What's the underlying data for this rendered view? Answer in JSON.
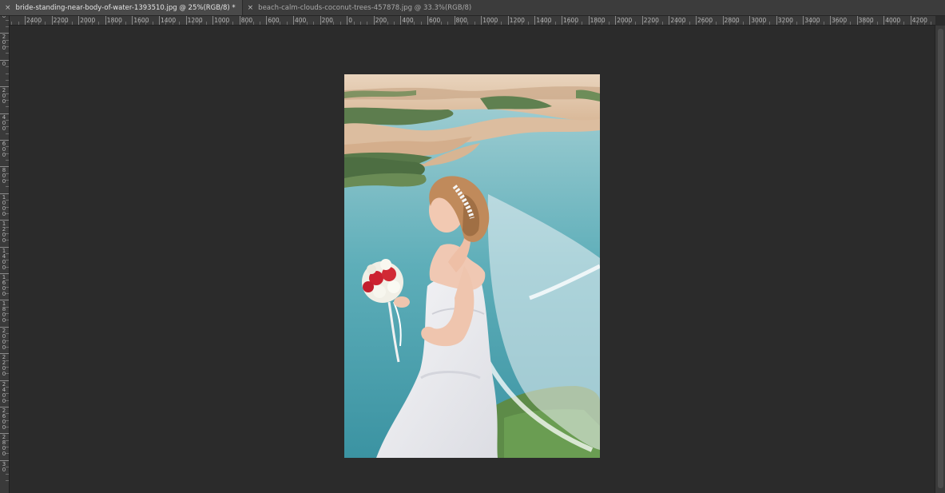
{
  "tabs": [
    {
      "label": "bride-standing-near-body-of-water-1393510.jpg @ 25%(RGB/8) *",
      "active": true,
      "close_icon": "×"
    },
    {
      "label": "beach-calm-clouds-coconut-trees-457878.jpg @ 33.3%(RGB/8)",
      "active": false,
      "close_icon": "×"
    }
  ],
  "ruler": {
    "horizontal_labels": [
      "2400",
      "2200",
      "2000",
      "1800",
      "1600",
      "1400",
      "1200",
      "1000",
      "800",
      "600",
      "400",
      "200",
      "0",
      "200",
      "400",
      "600",
      "800",
      "1000",
      "1200",
      "1400",
      "1600",
      "1800",
      "2000",
      "2200",
      "2400",
      "2600",
      "2800",
      "3000",
      "3200",
      "3400",
      "3600",
      "3800",
      "4000",
      "4200",
      "4"
    ],
    "vertical_labels": [
      "4\n0",
      "2\n0\n0",
      "0",
      "2\n0\n0",
      "4\n0\n0",
      "6\n0\n0",
      "8\n0\n0",
      "1\n0\n0\n0",
      "1\n2\n0\n0",
      "1\n4\n0\n0",
      "1\n6\n0\n0",
      "1\n8\n0\n0",
      "2\n0\n0\n0",
      "2\n2\n0\n0",
      "2\n4\n0\n0",
      "2\n6\n0\n0",
      "2\n8\n0\n0",
      "3\n0"
    ]
  },
  "document": {
    "image_subject": "bride-holding-bouquet-near-lake"
  },
  "colors": {
    "panel": "#2b2b2b",
    "tabbar": "#3c3c3c",
    "active_tab": "#4a4a4a",
    "ruler": "#3a3a3a"
  }
}
